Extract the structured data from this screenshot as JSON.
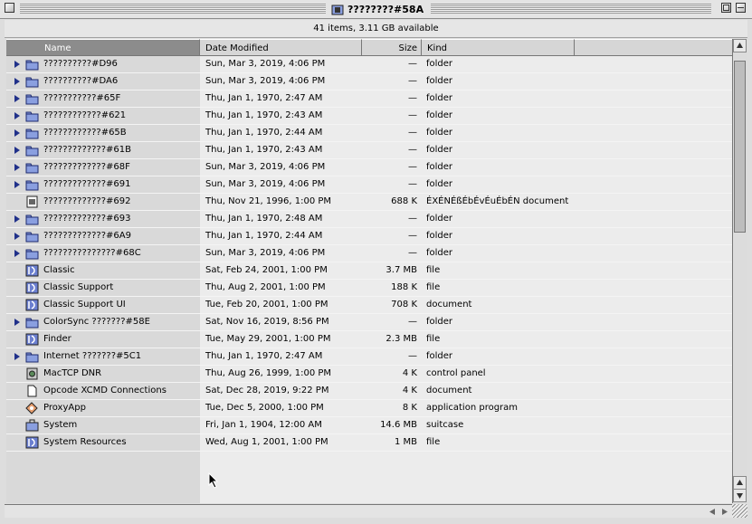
{
  "window": {
    "title": "????????#58A",
    "info": "41 items, 3.11 GB available"
  },
  "columns": {
    "name": "Name",
    "date": "Date Modified",
    "size": "Size",
    "kind": "Kind"
  },
  "colors": {
    "folder": "#8a9fe0",
    "disclosure": "#21318a",
    "nameColumn": "#d9d9d9"
  },
  "rows": [
    {
      "name": "??????????#D96",
      "date": "Sun, Mar 3, 2019, 4:06 PM",
      "size": "—",
      "kind": "folder",
      "icon": "folder-icon",
      "expandable": true
    },
    {
      "name": "??????????#DA6",
      "date": "Sun, Mar 3, 2019, 4:06 PM",
      "size": "—",
      "kind": "folder",
      "icon": "folder-icon",
      "expandable": true
    },
    {
      "name": "???????????#65F",
      "date": "Thu, Jan 1, 1970, 2:47 AM",
      "size": "—",
      "kind": "folder",
      "icon": "folder-icon",
      "expandable": true
    },
    {
      "name": "????????????#621",
      "date": "Thu, Jan 1, 1970, 2:43 AM",
      "size": "—",
      "kind": "folder",
      "icon": "folder-icon",
      "expandable": true
    },
    {
      "name": "????????????#65B",
      "date": "Thu, Jan 1, 1970, 2:44 AM",
      "size": "—",
      "kind": "folder",
      "icon": "folder-icon",
      "expandable": true
    },
    {
      "name": "?????????????#61B",
      "date": "Thu, Jan 1, 1970, 2:43 AM",
      "size": "—",
      "kind": "folder",
      "icon": "folder-icon",
      "expandable": true
    },
    {
      "name": "?????????????#68F",
      "date": "Sun, Mar 3, 2019, 4:06 PM",
      "size": "—",
      "kind": "folder",
      "icon": "folder-icon",
      "expandable": true
    },
    {
      "name": "?????????????#691",
      "date": "Sun, Mar 3, 2019, 4:06 PM",
      "size": "—",
      "kind": "folder",
      "icon": "folder-icon",
      "expandable": true
    },
    {
      "name": "?????????????#692",
      "date": "Thu, Nov 21, 1996, 1:00 PM",
      "size": "688 K",
      "kind": "ÉXÉNÉßÉbÉvÉuÉbÉN document",
      "icon": "document-icon",
      "expandable": false
    },
    {
      "name": "?????????????#693",
      "date": "Thu, Jan 1, 1970, 2:48 AM",
      "size": "—",
      "kind": "folder",
      "icon": "folder-icon",
      "expandable": true
    },
    {
      "name": "?????????????#6A9",
      "date": "Thu, Jan 1, 1970, 2:44 AM",
      "size": "—",
      "kind": "folder",
      "icon": "folder-icon",
      "expandable": true
    },
    {
      "name": "???????????????#68C",
      "date": "Sun, Mar 3, 2019, 4:06 PM",
      "size": "—",
      "kind": "folder",
      "icon": "folder-icon",
      "expandable": true
    },
    {
      "name": "Classic",
      "date": "Sat, Feb 24, 2001, 1:00 PM",
      "size": "3.7 MB",
      "kind": "file",
      "icon": "system-file-icon",
      "expandable": false
    },
    {
      "name": "Classic Support",
      "date": "Thu, Aug 2, 2001, 1:00 PM",
      "size": "188 K",
      "kind": "file",
      "icon": "system-file-icon",
      "expandable": false
    },
    {
      "name": "Classic Support UI",
      "date": "Tue, Feb 20, 2001, 1:00 PM",
      "size": "708 K",
      "kind": "document",
      "icon": "system-file-icon",
      "expandable": false
    },
    {
      "name": "ColorSync ???????#58E",
      "date": "Sat, Nov 16, 2019, 8:56 PM",
      "size": "—",
      "kind": "folder",
      "icon": "folder-icon",
      "expandable": true
    },
    {
      "name": "Finder",
      "date": "Tue, May 29, 2001, 1:00 PM",
      "size": "2.3 MB",
      "kind": "file",
      "icon": "system-file-icon",
      "expandable": false
    },
    {
      "name": "Internet ???????#5C1",
      "date": "Thu, Jan 1, 1970, 2:47 AM",
      "size": "—",
      "kind": "folder",
      "icon": "folder-icon",
      "expandable": true
    },
    {
      "name": "MacTCP DNR",
      "date": "Thu, Aug 26, 1999, 1:00 PM",
      "size": "4 K",
      "kind": "control panel",
      "icon": "control-panel-icon",
      "expandable": false
    },
    {
      "name": "Opcode XCMD Connections",
      "date": "Sat, Dec 28, 2019, 9:22 PM",
      "size": "4 K",
      "kind": "document",
      "icon": "blank-document-icon",
      "expandable": false
    },
    {
      "name": "ProxyApp",
      "date": "Tue, Dec 5, 2000, 1:00 PM",
      "size": "8 K",
      "kind": "application program",
      "icon": "application-icon",
      "expandable": false
    },
    {
      "name": "System",
      "date": "Fri, Jan 1, 1904, 12:00 AM",
      "size": "14.6 MB",
      "kind": "suitcase",
      "icon": "suitcase-icon",
      "expandable": false
    },
    {
      "name": "System Resources",
      "date": "Wed, Aug 1, 2001, 1:00 PM",
      "size": "1 MB",
      "kind": "file",
      "icon": "system-file-icon",
      "expandable": false
    }
  ]
}
